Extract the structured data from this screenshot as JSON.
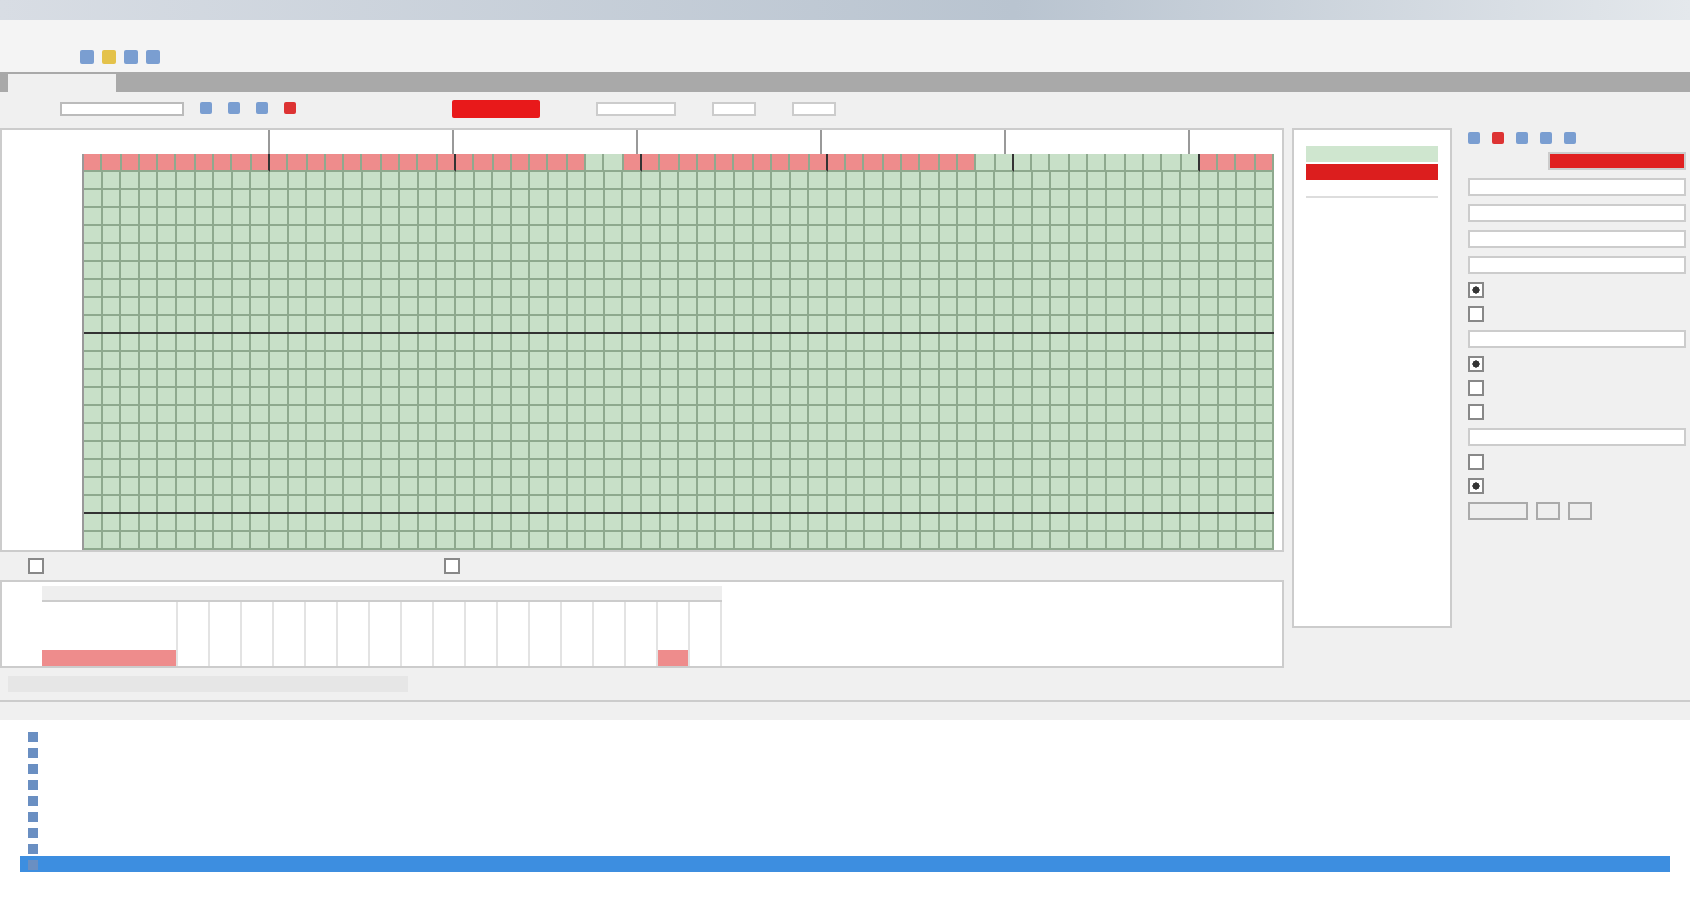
{
  "grid": {
    "rows": [
      {
        "cells": [
          true,
          true,
          true,
          true,
          true,
          true,
          true,
          true,
          true,
          true,
          true,
          true,
          true,
          true,
          true,
          true,
          true,
          true,
          true,
          true,
          true,
          true,
          true,
          true,
          true,
          true,
          true,
          false,
          false,
          true,
          true,
          true,
          true,
          true,
          true,
          true,
          true,
          true,
          true,
          true,
          true,
          true,
          true,
          true,
          true,
          true,
          true,
          true,
          false,
          false,
          false,
          false,
          false,
          false,
          false,
          false,
          false,
          false,
          false,
          false,
          true,
          true,
          true,
          true
        ]
      },
      {
        "failed": false
      },
      {
        "failed": false
      },
      {
        "failed": false
      },
      {
        "failed": false
      },
      {
        "failed": false
      },
      {
        "failed": false
      },
      {
        "failed": false
      },
      {
        "failed": false
      },
      {
        "failed": false
      },
      {
        "failed": false
      },
      {
        "failed": false
      },
      {
        "failed": false
      },
      {
        "failed": false
      },
      {
        "failed": false
      },
      {
        "failed": false
      },
      {
        "failed": false
      },
      {
        "failed": false
      },
      {
        "failed": false
      },
      {
        "failed": false
      },
      {
        "failed": false
      },
      {
        "failed": false
      }
    ]
  },
  "options": [
    {
      "checked": false
    },
    {
      "checked": false
    }
  ],
  "results_table": {
    "rows": [
      {
        "cells": [
          false,
          false,
          false,
          false,
          false,
          false,
          false,
          false,
          false,
          false,
          false,
          false,
          false,
          false,
          false,
          false,
          false,
          false
        ]
      },
      {
        "cells": [
          false,
          false,
          false,
          false,
          false,
          false,
          false,
          false,
          false,
          false,
          false,
          false,
          false,
          false,
          false,
          false,
          false,
          false
        ]
      },
      {
        "cells": [
          false,
          false,
          false,
          false,
          false,
          false,
          false,
          false,
          false,
          false,
          false,
          false,
          false,
          false,
          false,
          false,
          false,
          false
        ]
      },
      {
        "cells": [
          true,
          false,
          false,
          false,
          false,
          false,
          false,
          false,
          false,
          false,
          false,
          false,
          false,
          false,
          false,
          false,
          true,
          false
        ]
      }
    ]
  },
  "mini_table": {
    "rows": [
      {
        "kind": "pass"
      },
      {
        "kind": "fail"
      },
      {
        "kind": "empty"
      }
    ]
  },
  "settings": {
    "checks": [
      {
        "checked": true
      },
      {
        "checked": false
      },
      {
        "checked": true
      },
      {
        "checked": false
      },
      {
        "checked": false
      },
      {
        "checked": false
      },
      {
        "checked": true
      }
    ]
  },
  "log": {
    "items": [
      {
        "selected": false
      },
      {
        "selected": false
      },
      {
        "selected": false
      },
      {
        "selected": false
      },
      {
        "selected": false
      },
      {
        "selected": false
      },
      {
        "selected": false
      },
      {
        "selected": false
      },
      {
        "selected": true
      }
    ]
  }
}
